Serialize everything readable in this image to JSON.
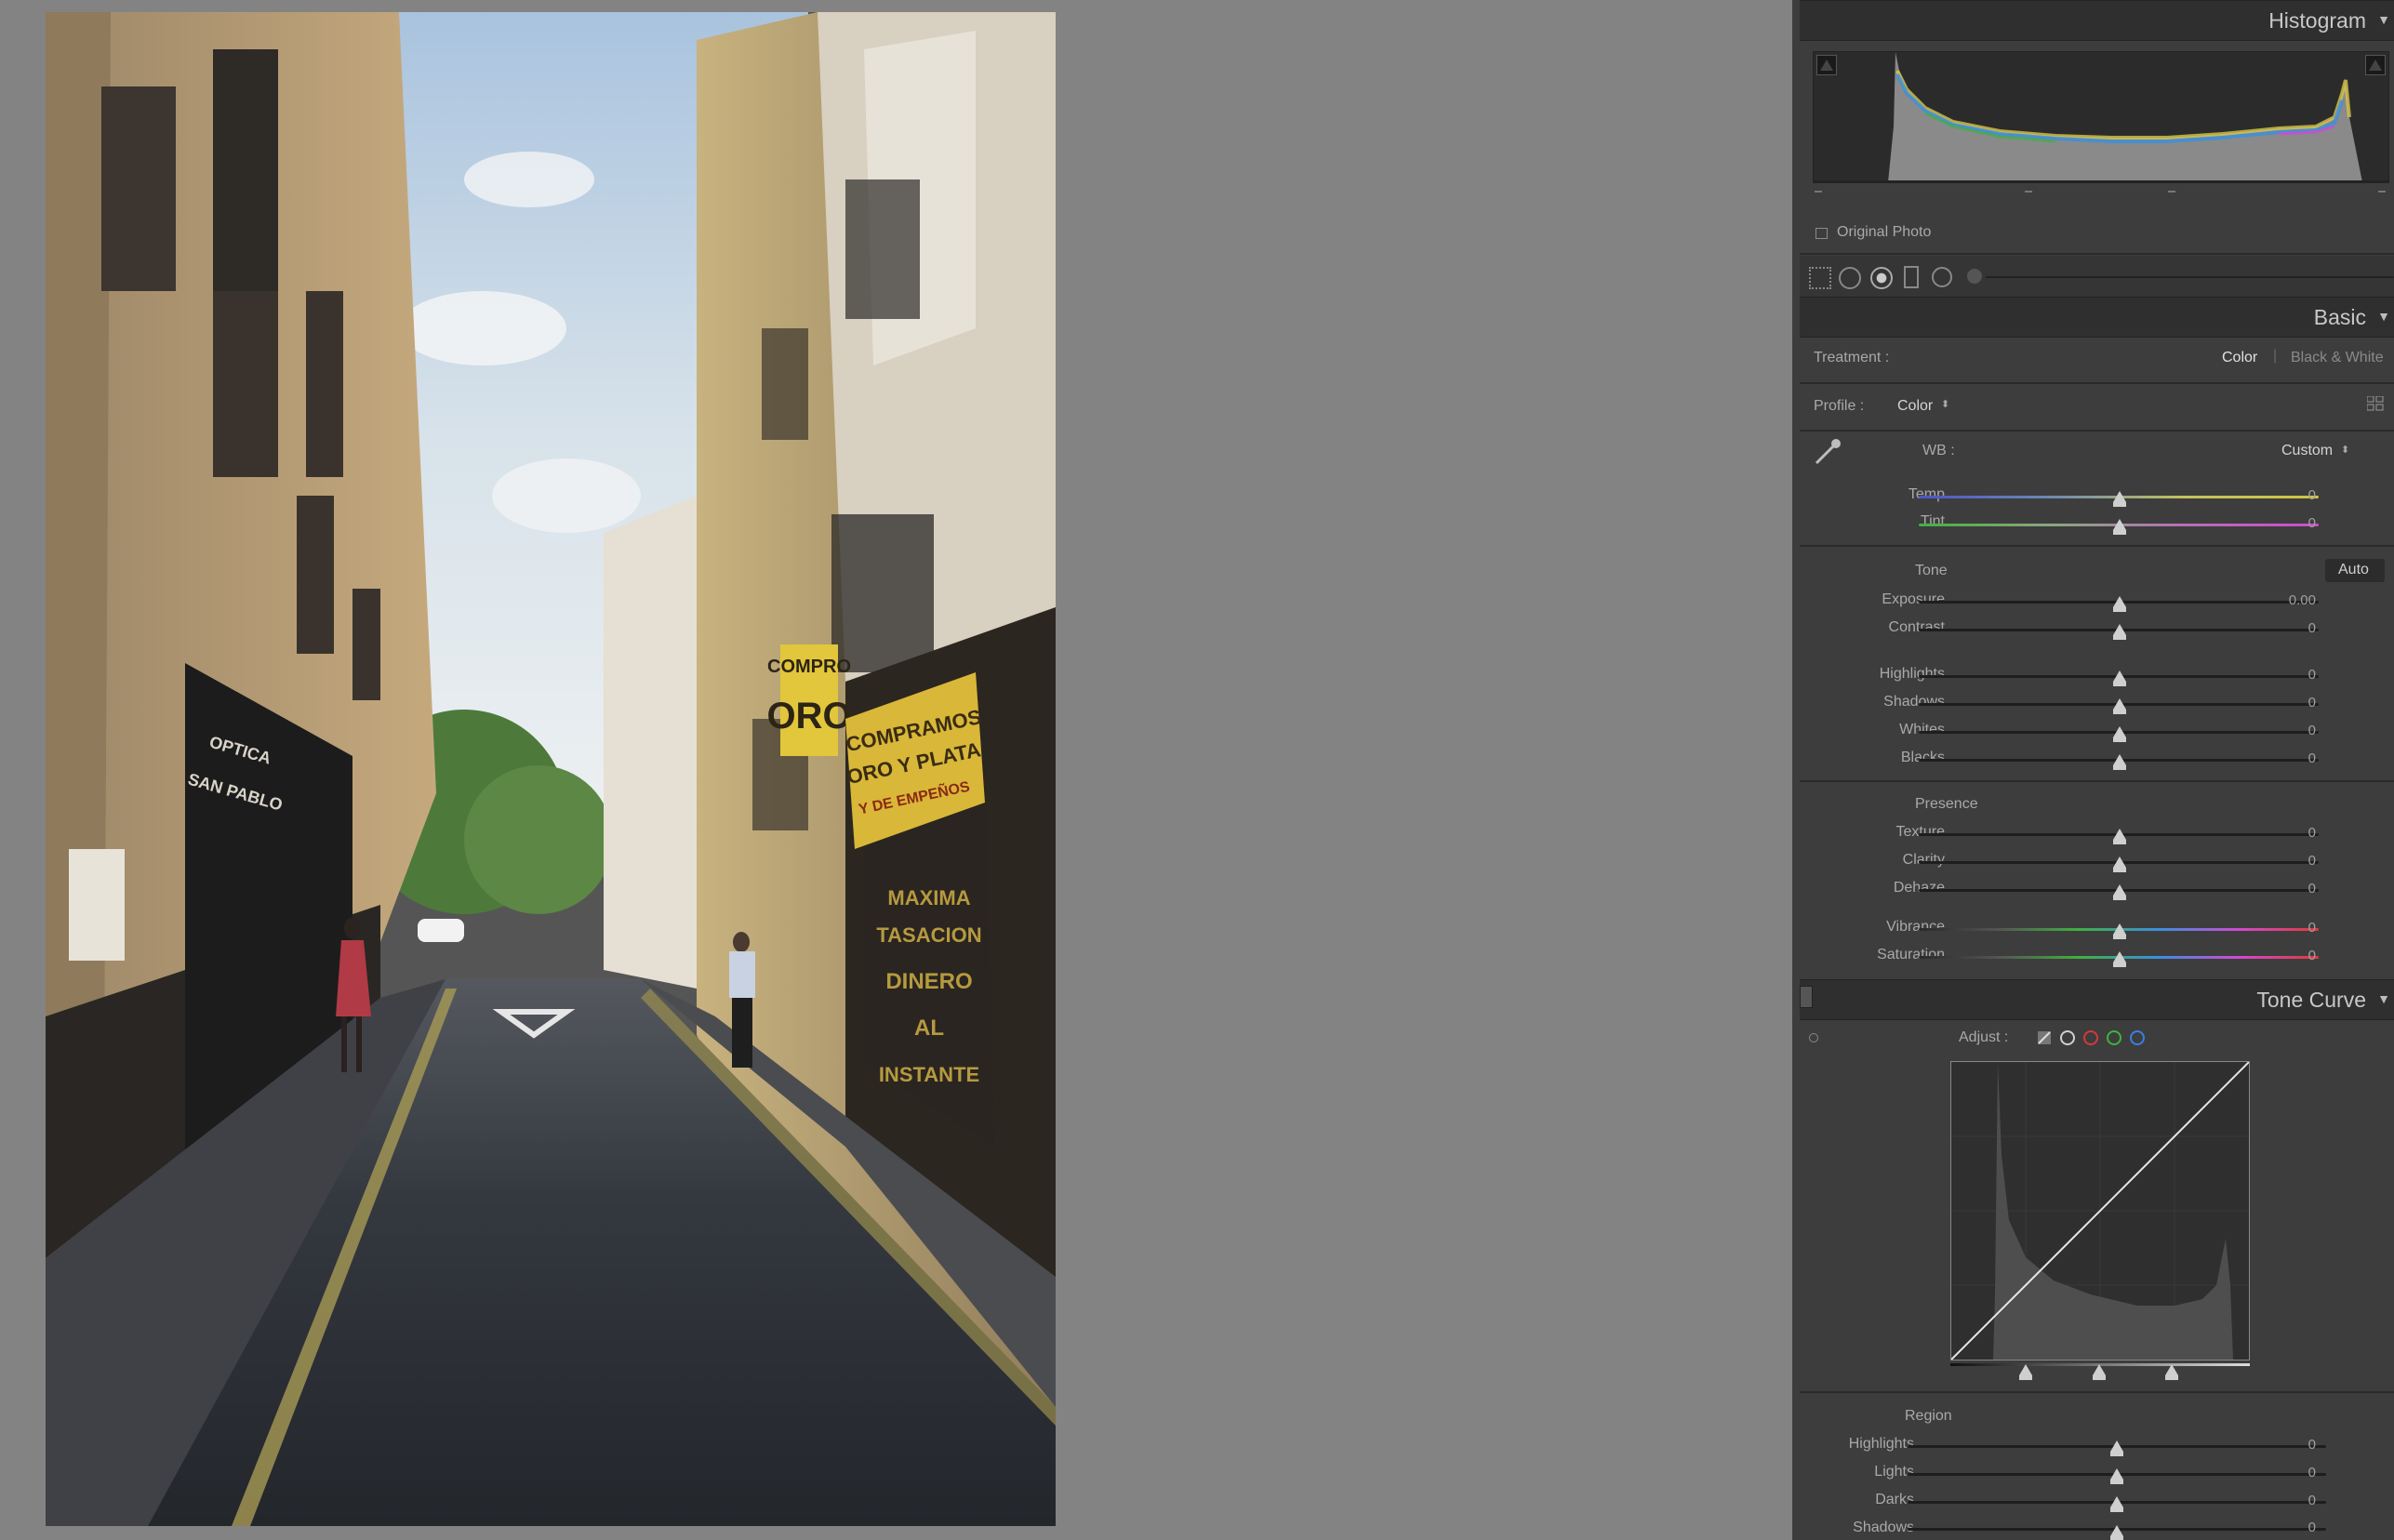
{
  "histogram": {
    "title": "Histogram",
    "original_photo_label": "Original Photo"
  },
  "basic": {
    "title": "Basic",
    "treatment_label": "Treatment :",
    "treatment_color": "Color",
    "treatment_divider": "|",
    "treatment_bw": "Black & White",
    "profile_label": "Profile :",
    "profile_value": "Color",
    "wb_label": "WB :",
    "wb_value": "Custom",
    "tone_label": "Tone",
    "auto_label": "Auto",
    "presence_label": "Presence",
    "sliders": [
      {
        "label": "Temp",
        "value": "0"
      },
      {
        "label": "Tint",
        "value": "0"
      },
      {
        "label": "Exposure",
        "value": "0.00"
      },
      {
        "label": "Contrast",
        "value": "0"
      },
      {
        "label": "Highlights",
        "value": "0"
      },
      {
        "label": "Shadows",
        "value": "0"
      },
      {
        "label": "Whites",
        "value": "0"
      },
      {
        "label": "Blacks",
        "value": "0"
      },
      {
        "label": "Texture",
        "value": "0"
      },
      {
        "label": "Clarity",
        "value": "0"
      },
      {
        "label": "Dehaze",
        "value": "0"
      },
      {
        "label": "Vibrance",
        "value": "0"
      },
      {
        "label": "Saturation",
        "value": "0"
      }
    ]
  },
  "tone_curve": {
    "title": "Tone Curve",
    "adjust_label": "Adjust :",
    "region_label": "Region",
    "sliders": [
      {
        "label": "Highlights",
        "value": "0"
      },
      {
        "label": "Lights",
        "value": "0"
      },
      {
        "label": "Darks",
        "value": "0"
      },
      {
        "label": "Shadows",
        "value": "0"
      }
    ]
  },
  "photo_signs": {
    "compro": "COMPRO",
    "oro": "ORO",
    "compramos_1": "COMPRAMOS",
    "compramos_2": "ORO Y PLATA",
    "compramos_3": "Y DE EMPEÑOS",
    "optica_1": "OPTICA",
    "optica_2": "SAN PABLO",
    "shutter_1": "MAXIMA",
    "shutter_2": "TASACION",
    "shutter_3": "DINERO",
    "shutter_4": "AL",
    "shutter_5": "INSTANTE"
  },
  "colors": {
    "background": "#838383",
    "panel": "#3d3d3d",
    "panel_header": "#2f2f2f"
  }
}
